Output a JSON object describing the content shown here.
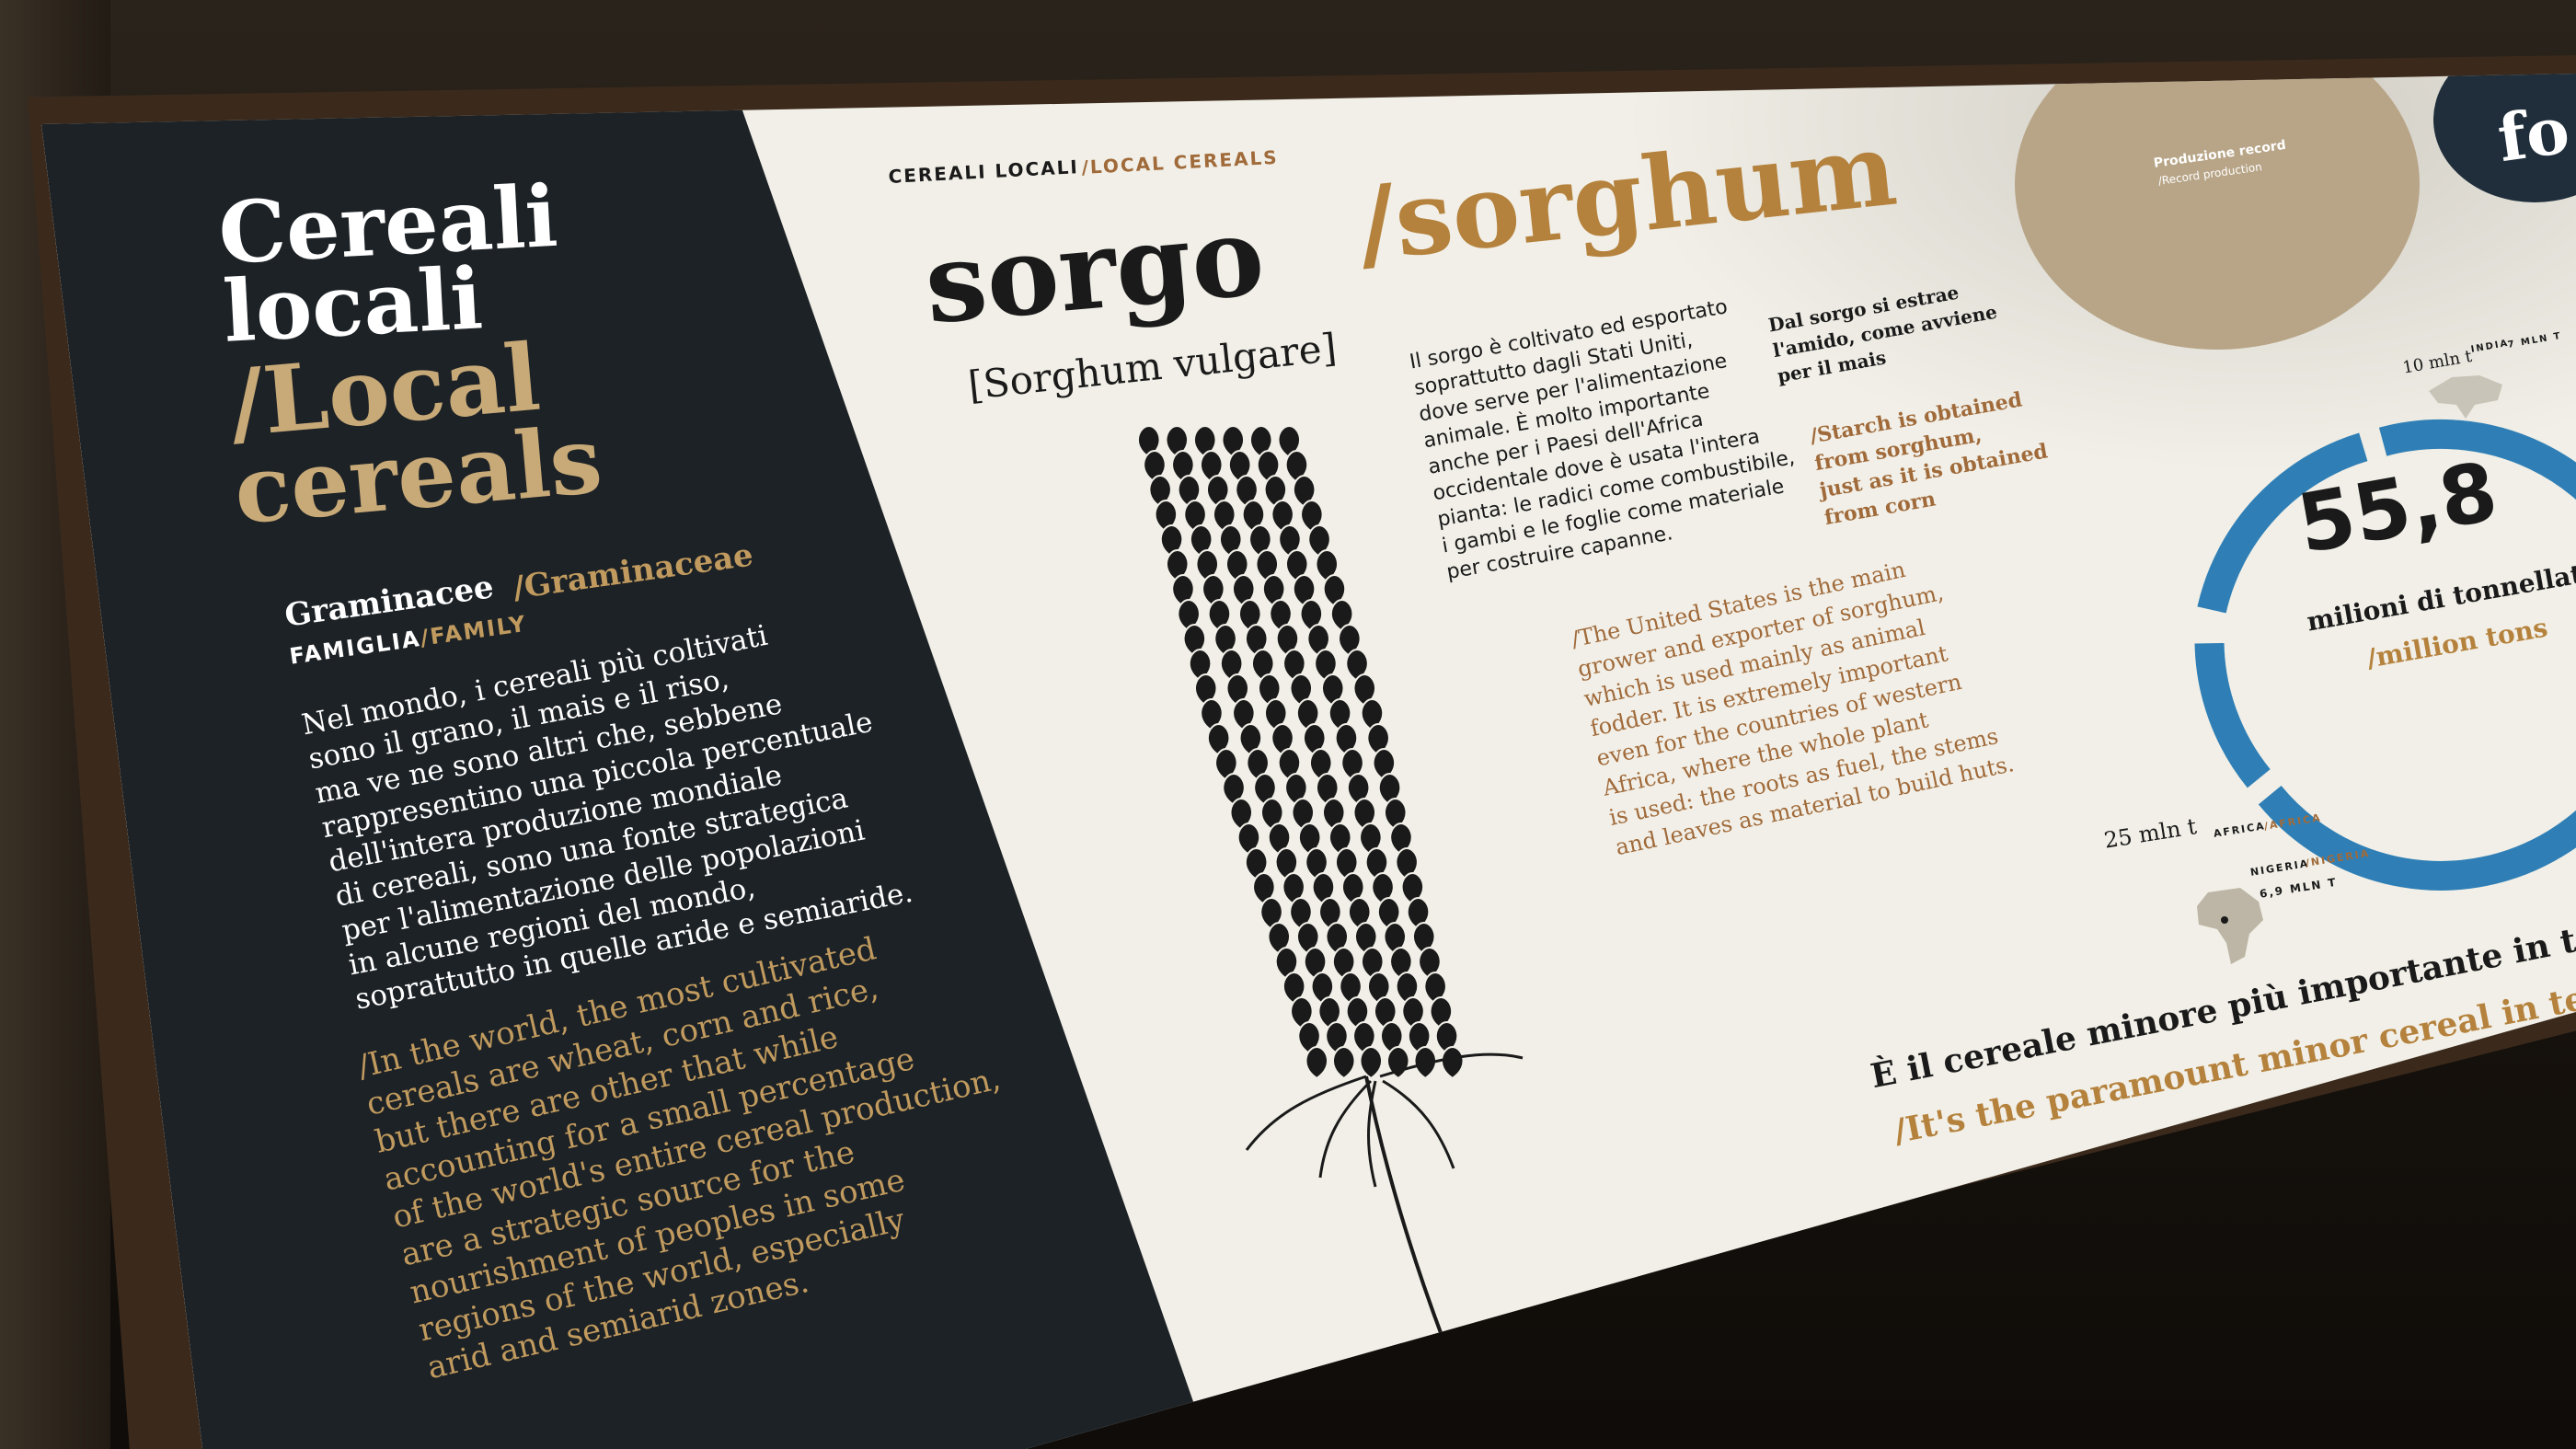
{
  "left_panel": {
    "title_it_line1": "Cereali",
    "title_it_line2": "locali",
    "title_en_line1": "/Local",
    "title_en_line2": "cereals",
    "family_it": "Graminacee",
    "family_en": "/Graminaceae",
    "family_label_it": "FAMIGLIA",
    "family_label_en": "/FAMILY",
    "intro_it": [
      "Nel mondo, i cereali più coltivati",
      "sono il grano, il mais e il riso,",
      "ma ve ne sono altri che, sebbene",
      "rappresentino una piccola percentuale",
      "dell'intera produzione mondiale",
      "di cereali, sono una fonte strategica",
      "per l'alimentazione delle popolazioni",
      "in alcune regioni del mondo,",
      "soprattutto in quelle aride e semiaride."
    ],
    "intro_en": [
      "/In the world, the most cultivated",
      "cereals are wheat, corn and rice,",
      "but there are other that while",
      "accounting for a small percentage",
      "of the world's entire cereal production,",
      "are a strategic source for the",
      "nourishment of peoples in some",
      "regions of the world, especially",
      "arid and semiarid zones."
    ]
  },
  "right_panel": {
    "breadcrumb_it": "CEREALI LOCALI",
    "breadcrumb_en": "/LOCAL CEREALS",
    "name_it": "sorgo",
    "name_en": "/sorghum",
    "latin_name": "[Sorghum vulgare]",
    "desc_it": [
      "Il sorgo è coltivato ed esportato",
      "soprattutto dagli Stati Uniti,",
      "dove serve per l'alimentazione",
      "animale. È molto importante",
      "anche per i Paesi dell'Africa",
      "occidentale dove è usata l'intera",
      "pianta: le radici come combustibile,",
      "i gambi e le foglie come materiale",
      "per costruire capanne."
    ],
    "desc_en": [
      "/The United States is the main",
      "grower and exporter of sorghum,",
      "which is used mainly as animal",
      "fodder. It is extremely important",
      "even for the countries of western",
      "Africa, where the whole plant",
      "is used: the roots as fuel, the stems",
      "and leaves as material to build huts."
    ],
    "starch_it": [
      "Dal sorgo si estrae",
      "l'amido, come avviene",
      "per il mais"
    ],
    "starch_en": [
      "/Starch is obtained",
      "from sorghum,",
      "just as it is obtained",
      "from corn"
    ],
    "production_value": "55,8",
    "production_unit_it": "milioni di tonnellate",
    "production_unit_en": "/million tons",
    "india_value": "10 mln t",
    "india_label": "INDIA",
    "india_label_en": "/INDIA",
    "india_amount": "7 MLN T",
    "africa_value": "25 mln t",
    "africa_label": "AFRICA",
    "africa_label_en": "/AFRICA",
    "nigeria_label": "NIGERIA",
    "nigeria_label_en": "/NIGERIA",
    "nigeria_amount": "6,9 MLN T",
    "record_title": "Produzione record",
    "record_title_en": "/Record production",
    "partial_word": "fo",
    "bottom_it": "È il cereale minore più importante in termini quantitativi e di diffu",
    "bottom_en": "/It's the paramount minor cereal in terms of quantity and widesp",
    "colors": {
      "dark_panel": "#1d2226",
      "gold": "#c09a5e",
      "brown": "#a06a3a",
      "donut_blue": "#2f7fb6",
      "beige_circle": "#b8a587"
    }
  }
}
